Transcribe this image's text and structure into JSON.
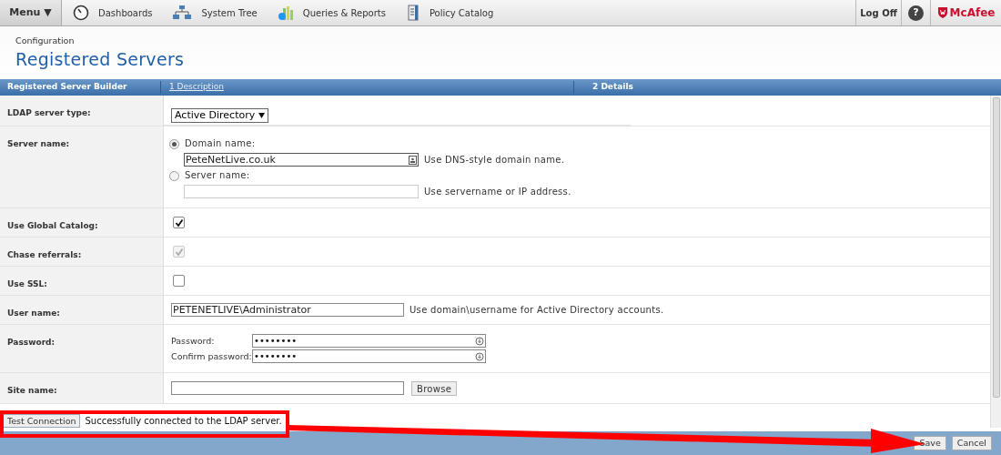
{
  "nav": {
    "menu": "Menu ▼",
    "items": [
      {
        "kind": "dashboard",
        "label": "Dashboards"
      },
      {
        "kind": "tree",
        "label": "System Tree"
      },
      {
        "kind": "reports",
        "label": "Queries & Reports"
      },
      {
        "kind": "catalog",
        "label": "Policy Catalog"
      }
    ],
    "logoff": "Log Off",
    "help": "?",
    "brand": "McAfee"
  },
  "breadcrumb": "Configuration",
  "title": "Registered Servers",
  "wizard": {
    "builder": "Registered Server Builder",
    "steps": [
      {
        "label": "1 Description",
        "selected": false
      },
      {
        "label": "2 Details",
        "selected": true
      }
    ]
  },
  "rows": [
    {
      "kind": "select",
      "label": "LDAP server type:",
      "value": "Active Directory"
    },
    {
      "kind": "radios",
      "label": "Server name:",
      "options": [
        {
          "label": "Domain name:",
          "selected": true,
          "value": "PeteNetLive.co.uk",
          "hint": "Use DNS-style domain name."
        },
        {
          "label": "Server name:",
          "selected": false,
          "hint": "Use servername or IP address."
        }
      ]
    },
    {
      "kind": "checkbox",
      "label": "Use Global Catalog:",
      "checked": true,
      "disabled": false
    },
    {
      "kind": "checkbox",
      "label": "Chase referrals:",
      "checked": true,
      "disabled": true
    },
    {
      "kind": "checkbox",
      "label": "Use SSL:",
      "checked": false,
      "disabled": false
    },
    {
      "kind": "text",
      "label": "User name:",
      "value": "PETENETLIVE\\Administrator",
      "hint": "Use domain\\username for Active Directory accounts."
    },
    {
      "kind": "password",
      "label": "Password:",
      "fields": [
        {
          "label": "Password:",
          "value": "••••••••"
        },
        {
          "label": "Confirm password:",
          "value": "••••••••"
        }
      ]
    },
    {
      "kind": "browse",
      "label": "Site name:",
      "button": "Browse"
    }
  ],
  "test": {
    "button": "Test Connection",
    "message": "Successfully connected to the LDAP server."
  },
  "footer": {
    "buttons": [
      "Save",
      "Cancel"
    ]
  }
}
